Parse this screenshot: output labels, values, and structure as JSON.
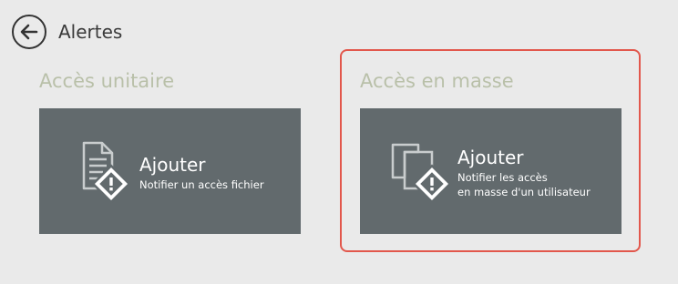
{
  "header": {
    "back_icon": "arrow-left-icon",
    "title": "Alertes"
  },
  "sections": [
    {
      "title": "Accès unitaire",
      "tile": {
        "icon": "document-warning-icon",
        "label": "Ajouter",
        "description_lines": [
          "Notifier un accès fichier"
        ]
      }
    },
    {
      "title": "Accès en masse",
      "highlighted": true,
      "tile": {
        "icon": "documents-warning-icon",
        "label": "Ajouter",
        "description_lines": [
          "Notifier les accès",
          "en masse d'un utilisateur"
        ]
      }
    }
  ],
  "colors": {
    "background": "#eaeaea",
    "tile_background": "#626a6d",
    "section_title": "#b9c0a9",
    "highlight_border": "#e2574c"
  }
}
